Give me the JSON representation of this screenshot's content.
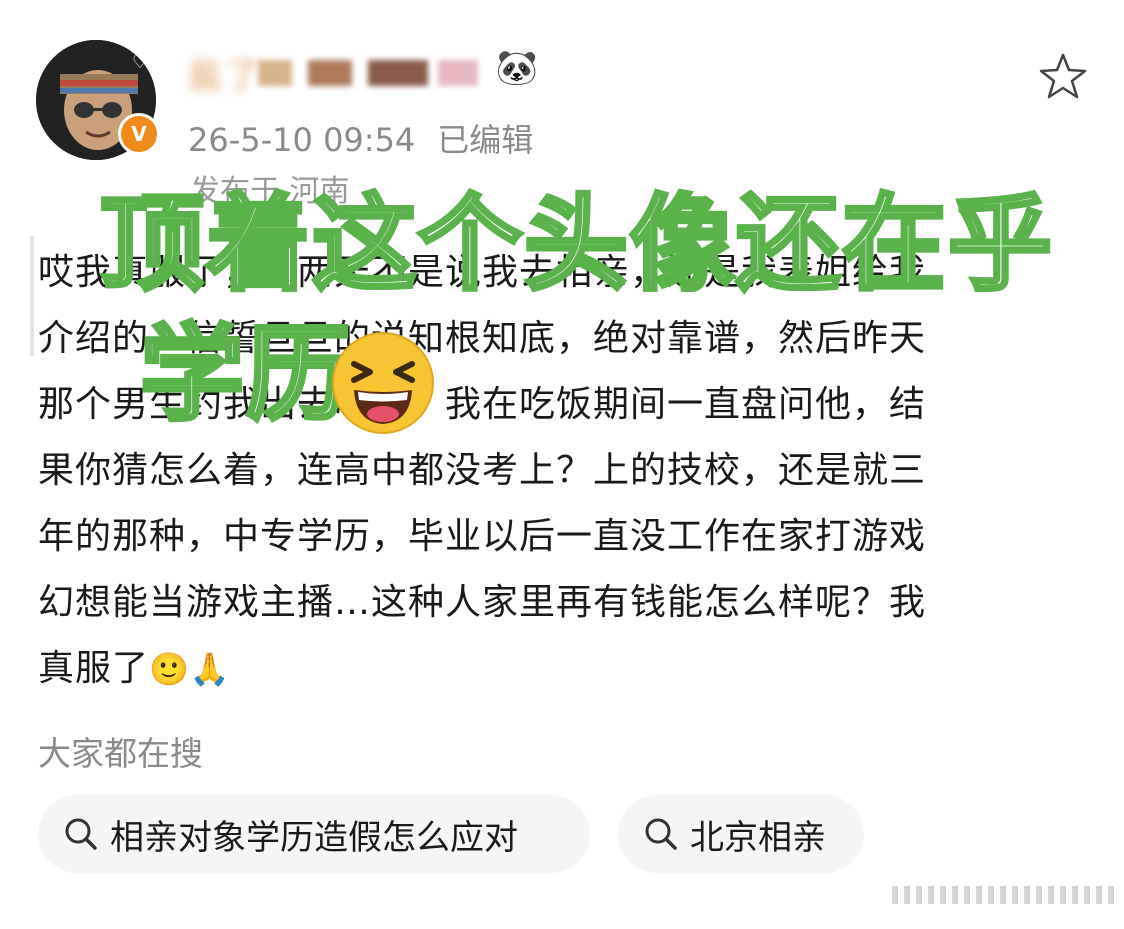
{
  "post": {
    "username": "盐了",
    "username_decoration": "🐼",
    "timestamp": "26-5-10 09:54",
    "edited": "已编辑",
    "location": "发布于 河南",
    "avatar_badge": "V",
    "body_lines": [
      "哎我真服了，前两天不是说我去相亲，还是我表姐给我",
      "介绍的，信誓旦旦的说知根知底，绝对靠谱，然后昨天",
      "那个男生约我出去吃饭，我在吃饭期间一直盘问他，结",
      "果你猜怎么着，连高中都没考上？上的技校，还是就三",
      "年的那种，中专学历，毕业以后一直没工作在家打游戏",
      "幻想能当游戏主播…这种人家里再有钱能怎么样呢？我",
      "真服了"
    ],
    "body_end_emojis": "🙂🙏"
  },
  "overlay": {
    "line1": "顶着这个头像还在乎",
    "line2": "学历"
  },
  "trending": {
    "label": "大家都在搜",
    "items": [
      {
        "text": "相亲对象学历造假怎么应对"
      },
      {
        "text": "北京相亲"
      }
    ]
  },
  "icons": {
    "favorite": "star-outline-icon",
    "search": "search-icon",
    "overlay_emoji": "laughing-face-emoji"
  },
  "colors": {
    "overlay_stroke": "#59b24a",
    "badge": "#f08a1b",
    "meta_text": "#8a8a8a",
    "pill_bg": "#f5f5f5"
  }
}
